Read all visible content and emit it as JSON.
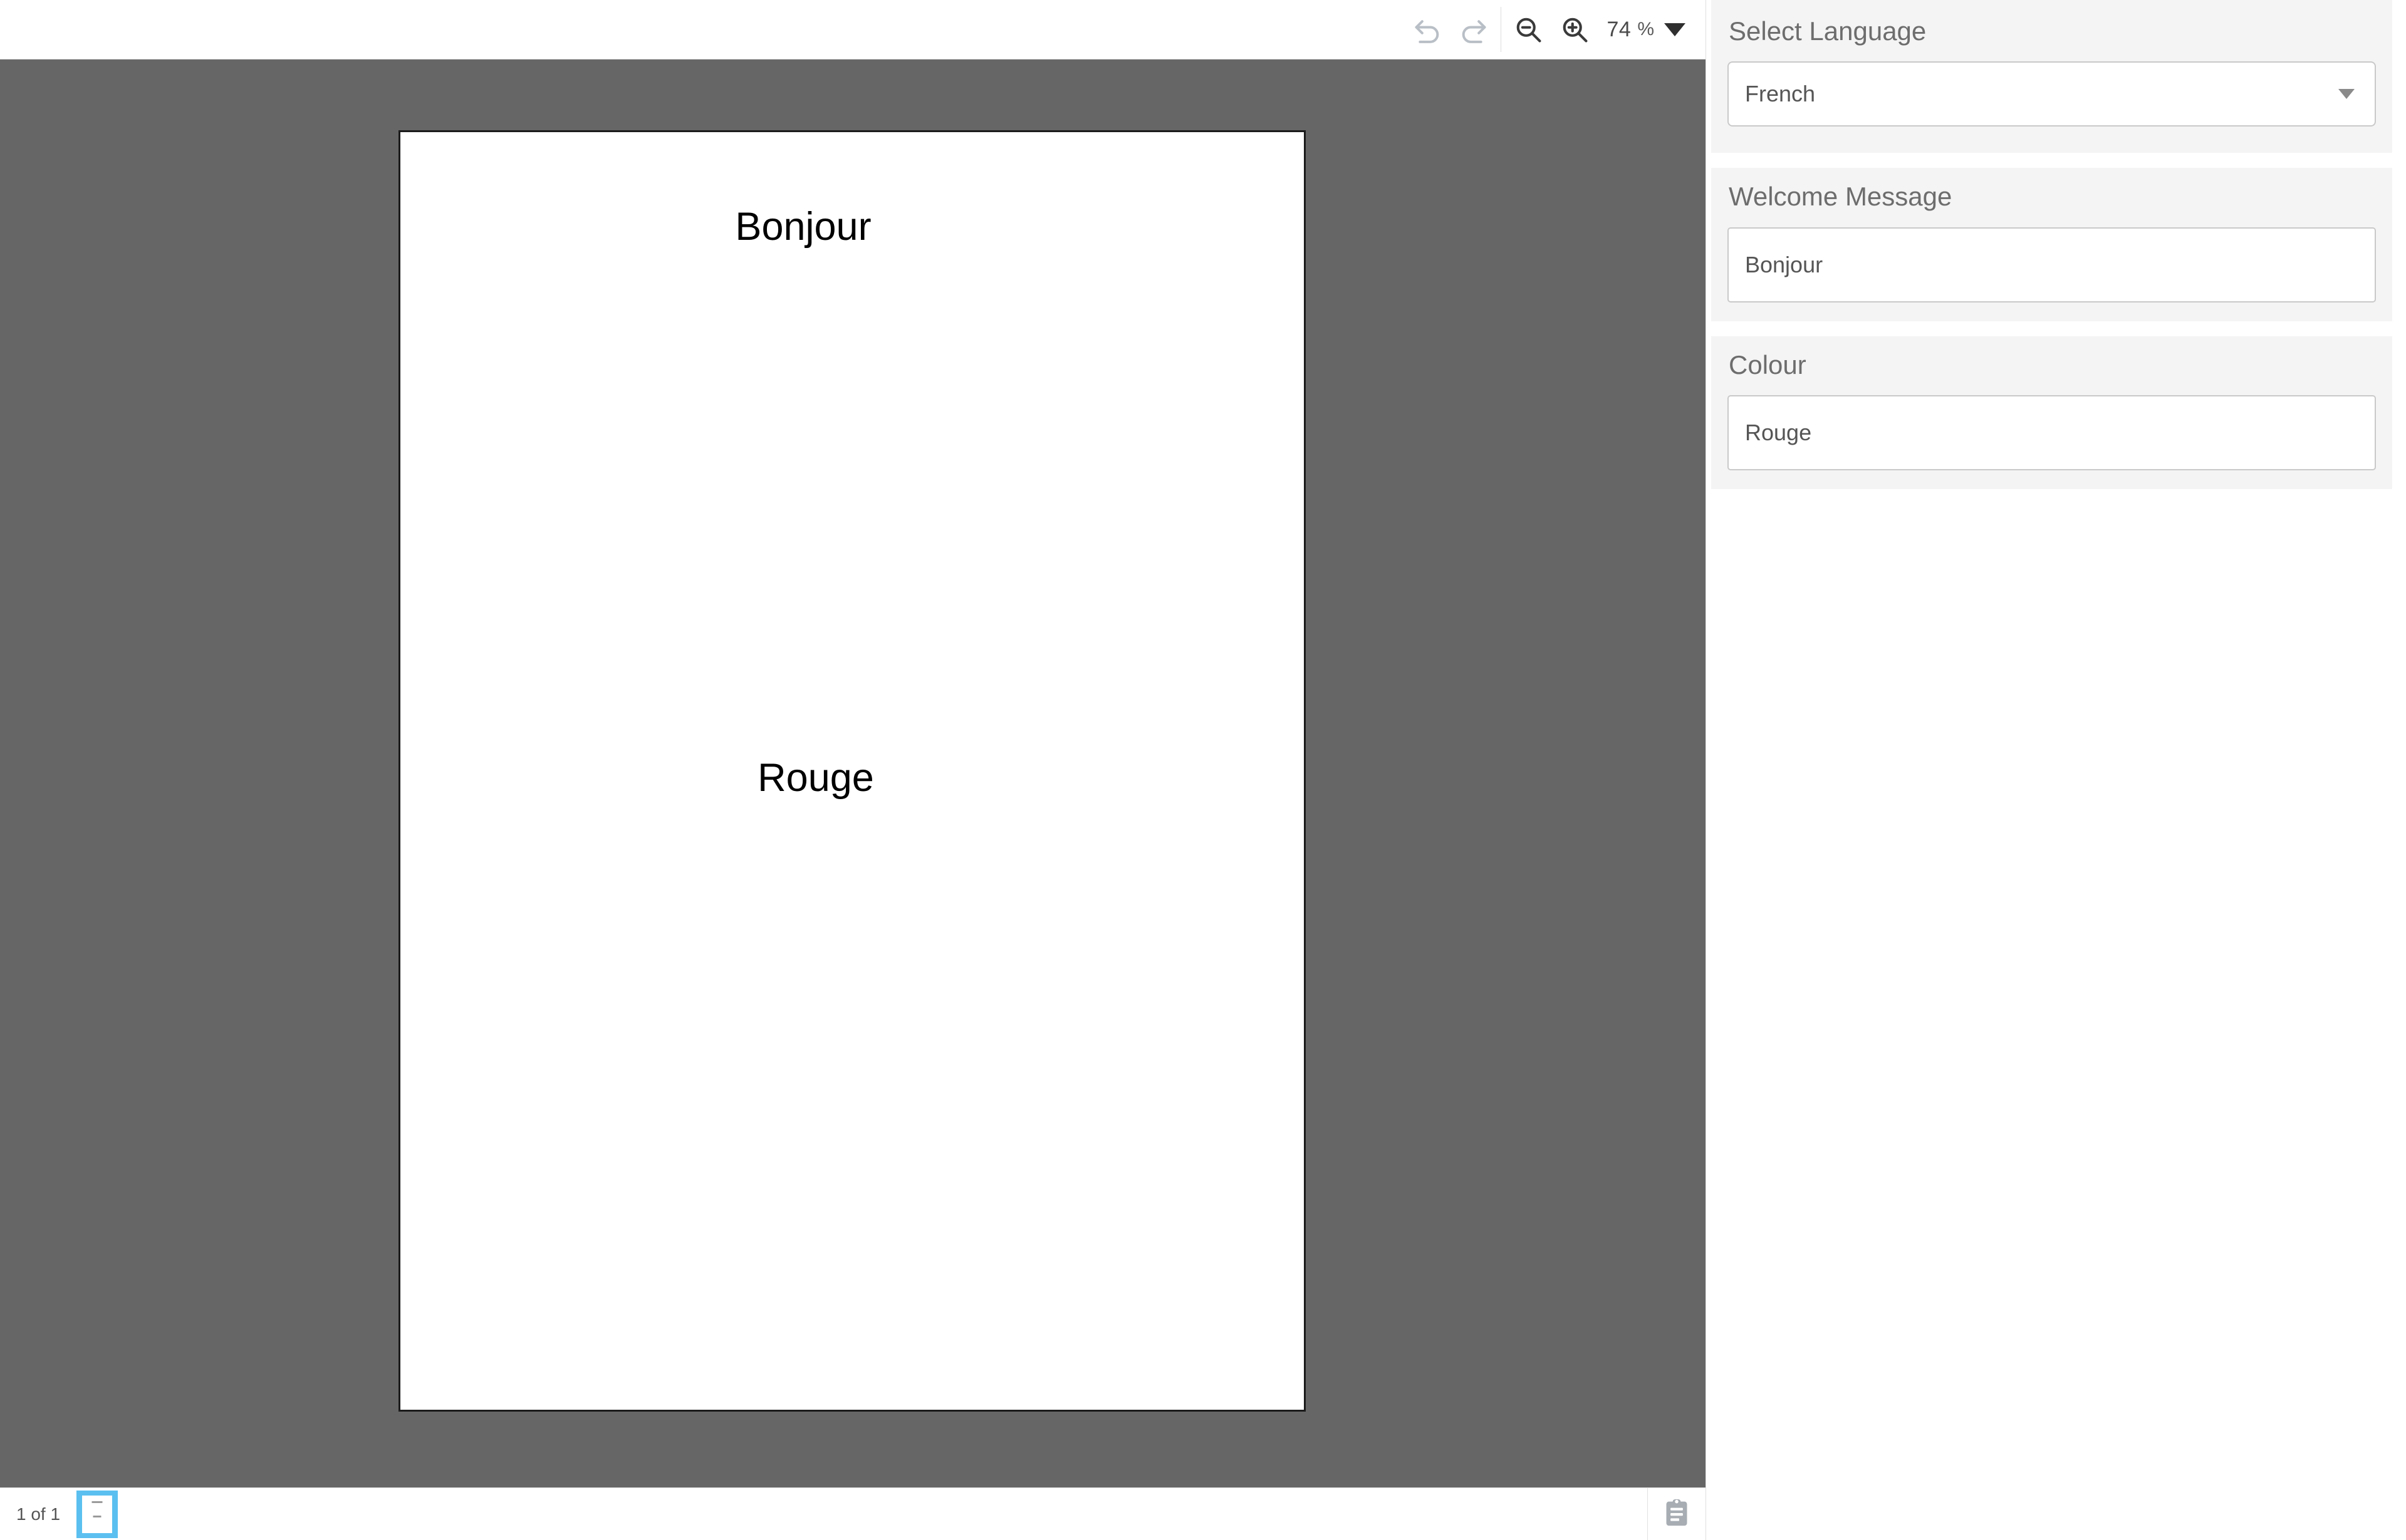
{
  "toolbar": {
    "undo_label": "Undo",
    "redo_label": "Redo",
    "zoom_out_label": "Zoom Out",
    "zoom_in_label": "Zoom In",
    "zoom_value": "74",
    "zoom_unit": "%",
    "zoom_dropdown_label": "Zoom presets"
  },
  "document": {
    "greeting": "Bonjour",
    "colour": "Rouge"
  },
  "statusbar": {
    "page_count": "1 of 1",
    "thumbnail_label": "Page 1 thumbnail",
    "clipboard_label": "Clipboard"
  },
  "panel": {
    "language": {
      "title": "Select Language",
      "selected": "French"
    },
    "welcome": {
      "title": "Welcome Message",
      "value": "Bonjour"
    },
    "colour": {
      "title": "Colour",
      "value": "Rouge"
    }
  },
  "colors": {
    "canvas": "#666666",
    "card_bg": "#f4f4f4",
    "selection_blue": "#5bc0f0",
    "title_gray": "#6d6d6d"
  }
}
